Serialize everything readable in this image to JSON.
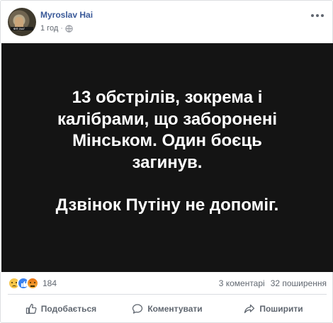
{
  "post": {
    "author": "Myroslav Hai",
    "time": "1 год",
    "separator": "·",
    "avatar_text": "ФП ЗАГ"
  },
  "image_text": {
    "lines": [
      "13 обстрілів, зокрема і",
      "калібрами, що заборонені",
      "Мінськом. Один боєць",
      "загинув.",
      "Дзвінок Путіну не допоміг."
    ],
    "background": "#141414",
    "color": "#ffffff"
  },
  "stats": {
    "reactions": [
      "sad",
      "like",
      "angry"
    ],
    "reaction_count": "184",
    "comments": "3 коментарі",
    "shares": "32 поширення"
  },
  "actions": {
    "like": "Подобається",
    "comment": "Коментувати",
    "share": "Поширити"
  },
  "colors": {
    "author_link": "#385898",
    "secondary_text": "#606770",
    "like_blue": "#3b82f0"
  }
}
